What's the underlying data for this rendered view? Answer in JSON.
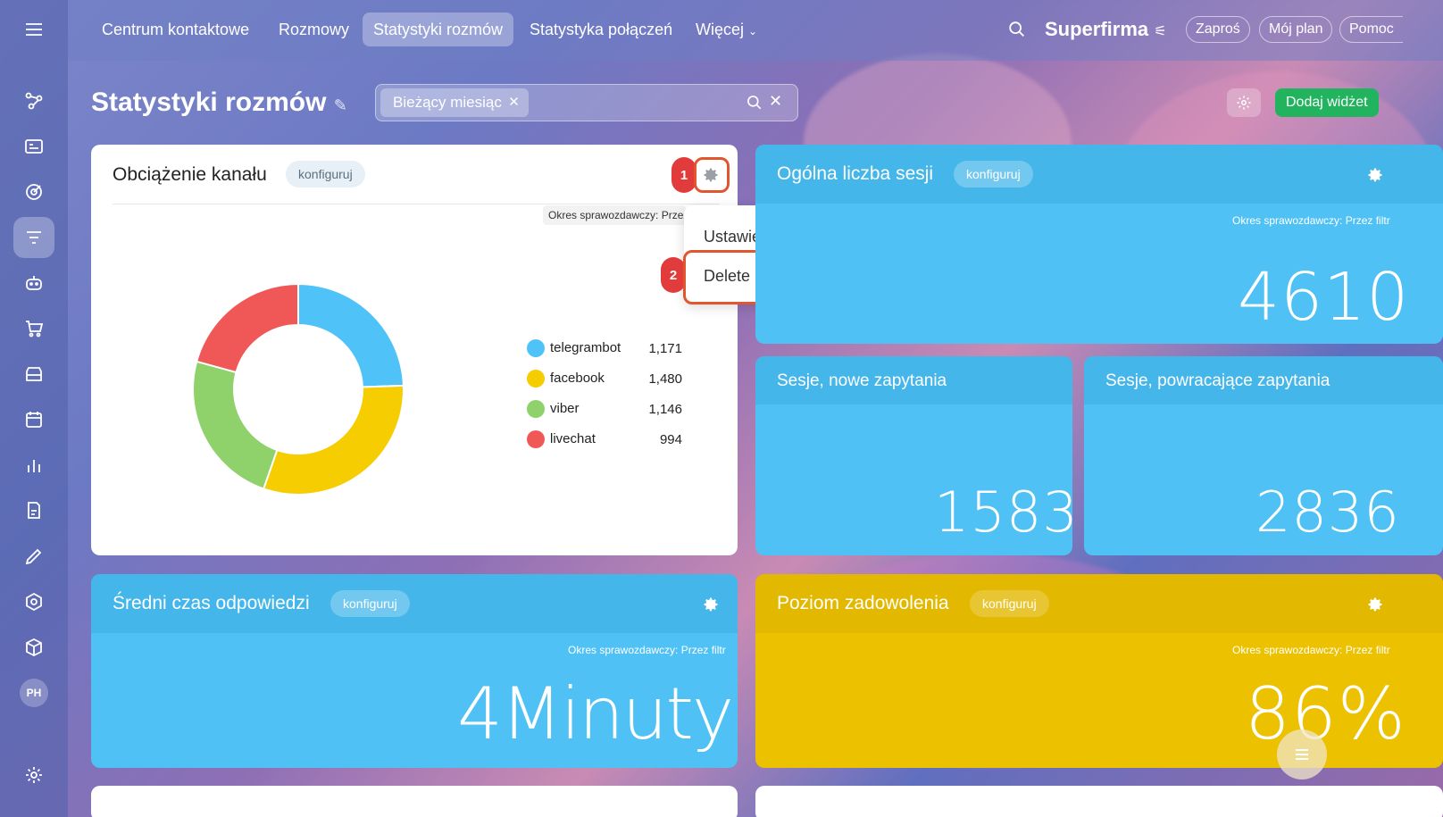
{
  "topbar": {
    "tabs": [
      {
        "label": "Centrum kontaktowe",
        "active": false
      },
      {
        "label": "Rozmowy",
        "active": false
      },
      {
        "label": "Statystyki rozmów",
        "active": true
      },
      {
        "label": "Statystyka połączeń",
        "active": false
      },
      {
        "label": "Więcej",
        "active": false
      }
    ],
    "brand": "Superfirma",
    "invite_label": "Zaproś",
    "plan_label": "Mój plan",
    "help_label": "Pomoc"
  },
  "page": {
    "title": "Statystyki rozmów",
    "filter_chip": "Bieżący miesiąc",
    "add_widget_label": "Dodaj widżet"
  },
  "sidebar": {
    "avatar_initials": "PH"
  },
  "channel_load": {
    "title": "Obciążenie kanału",
    "configure_label": "konfiguruj",
    "period_tooltip": "Okres sprawozdawczy: Przez filtr",
    "menu": {
      "settings_label": "Ustawienia",
      "delete_label": "Delete"
    },
    "step1": "1",
    "step2": "2"
  },
  "chart_data": {
    "type": "pie",
    "categories": [
      "telegrambot",
      "facebook",
      "viber",
      "livechat"
    ],
    "values": [
      1171,
      1480,
      1146,
      994
    ],
    "value_labels": [
      "1,171",
      "1,480",
      "1,146",
      "994"
    ],
    "colors": [
      "#4fc3f7",
      "#f5cd00",
      "#8fd16b",
      "#f05858"
    ],
    "legend": "right"
  },
  "widgets": {
    "total_sessions": {
      "title": "Ogólna liczba sesji",
      "configure_label": "konfiguruj",
      "period": "Okres sprawozdawczy: Przez filtr",
      "value": "4610"
    },
    "new_sessions": {
      "title": "Sesje, nowe zapytania",
      "value": "1583"
    },
    "returning_sessions": {
      "title": "Sesje, powracające zapytania",
      "value": "2836"
    },
    "avg_response": {
      "title": "Średni czas odpowiedzi",
      "configure_label": "konfiguruj",
      "period": "Okres sprawozdawczy: Przez filtr",
      "value": "4Minuty"
    },
    "satisfaction": {
      "title": "Poziom zadowolenia",
      "configure_label": "konfiguruj",
      "period": "Okres sprawozdawczy: Przez filtr",
      "value": "86%"
    }
  },
  "colors": {
    "blue_widget": "#4fc1f5",
    "yellow_widget": "#ecc100",
    "accent_green": "#22b35f",
    "highlight": "#e2562f"
  }
}
